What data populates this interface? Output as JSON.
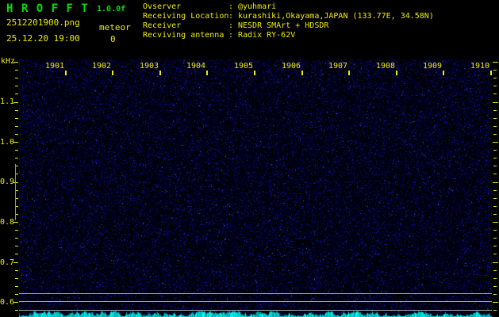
{
  "app": {
    "title": "H R O F F T",
    "version": "1.0.0f"
  },
  "session": {
    "filename": "2512201900.png",
    "datetime": "25.12.20 19:00",
    "meteor_label": "meteor",
    "meteor_count": "0"
  },
  "metadata": {
    "separator": ":",
    "rows": [
      {
        "label": "Ovserver",
        "value": "@yuhmari"
      },
      {
        "label": "Receiving Location",
        "value": "kurashiki,Okayama,JAPAN (133.77E, 34.58N)"
      },
      {
        "label": "Receiver",
        "value": "NESDR SMArt + HDSDR"
      },
      {
        "label": "Recviving antenna",
        "value": "Radix RY-62V"
      }
    ]
  },
  "chart_data": {
    "type": "heatmap",
    "description": "HROFFT radio meteor observation spectrogram, 10 minutes of background noise with no meteor echoes",
    "freq_axis": {
      "unit": "kHz",
      "top_khz": 1.2,
      "bottom_khz": 0.58,
      "minor_step_khz": 0.02,
      "major_step_khz": 0.1,
      "major_labels": [
        "1.1",
        "1.0",
        "0.9",
        "0.8",
        "0.7",
        "0.6"
      ],
      "major_values": [
        1.1,
        1.0,
        0.9,
        0.8,
        0.7,
        0.6
      ]
    },
    "time_axis": {
      "labels": [
        "1901",
        "1902",
        "1903",
        "1904",
        "1905",
        "1906",
        "1907",
        "1908",
        "1909",
        "1910"
      ],
      "minutes_span": 10
    },
    "carrier_lines_khz": [
      0.622,
      0.601,
      0.58
    ],
    "calibration_bar_khz": {
      "from": 0.944,
      "to": 0.804
    },
    "meteor_echo_count": 0
  },
  "colors": {
    "accent_green": "#00DD00",
    "accent_yellow": "#ECEC00",
    "carrier_gray": "#A8A8A8",
    "calib_gray": "#909090",
    "signal_cyan": "#00E0E0",
    "background": "#000000"
  }
}
